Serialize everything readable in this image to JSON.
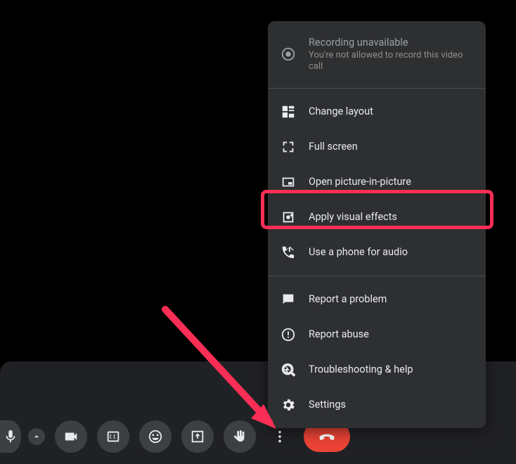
{
  "menu": {
    "recording_title": "Recording unavailable",
    "recording_sub": "You're not allowed to record this video call",
    "change_layout": "Change layout",
    "full_screen": "Full screen",
    "pip": "Open picture-in-picture",
    "visual_effects": "Apply visual effects",
    "phone_audio": "Use a phone for audio",
    "report_problem": "Report a problem",
    "report_abuse": "Report abuse",
    "troubleshoot": "Troubleshooting & help",
    "settings": "Settings"
  }
}
